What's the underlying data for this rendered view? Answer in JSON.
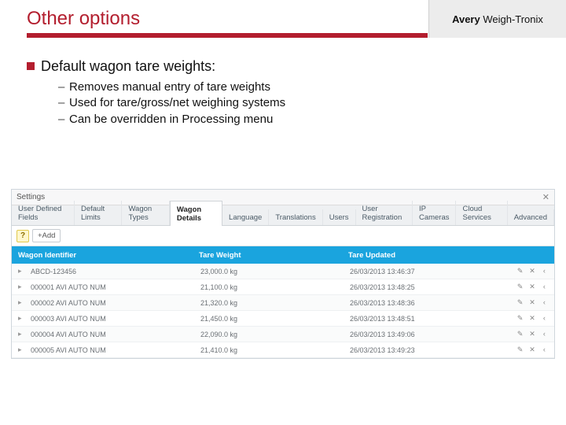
{
  "slide": {
    "title": "Other options",
    "brand": {
      "bold": "Avery",
      "rest": " Weigh-Tronix"
    },
    "heading": "Default wagon tare weights:",
    "subs": [
      "Removes manual entry of tare weights",
      "Used for tare/gross/net weighing systems",
      "Can be overridden in Processing menu"
    ]
  },
  "app": {
    "window_title": "Settings",
    "tabs": [
      "User Defined Fields",
      "Default Limits",
      "Wagon Types",
      "Wagon Details",
      "Language",
      "Translations",
      "Users",
      "User Registration",
      "IP Cameras",
      "Cloud Services",
      "Advanced"
    ],
    "active_tab_index": 3,
    "toolbar": {
      "help": "?",
      "add": "+Add"
    },
    "columns": {
      "id": "Wagon Identifier",
      "wt": "Tare Weight",
      "upd": "Tare Updated"
    },
    "rows": [
      {
        "id": "ABCD-123456",
        "wt": "23,000.0 kg",
        "upd": "26/03/2013 13:46:37"
      },
      {
        "id": "000001 AVI AUTO NUM",
        "wt": "21,100.0 kg",
        "upd": "26/03/2013 13:48:25"
      },
      {
        "id": "000002 AVI AUTO NUM",
        "wt": "21,320.0 kg",
        "upd": "26/03/2013 13:48:36"
      },
      {
        "id": "000003 AVI AUTO NUM",
        "wt": "21,450.0 kg",
        "upd": "26/03/2013 13:48:51"
      },
      {
        "id": "000004 AVI AUTO NUM",
        "wt": "22,090.0 kg",
        "upd": "26/03/2013 13:49:06"
      },
      {
        "id": "000005 AVI AUTO NUM",
        "wt": "21,410.0 kg",
        "upd": "26/03/2013 13:49:23"
      }
    ],
    "icons": {
      "expand": "▸",
      "edit": "✎",
      "delete": "✕",
      "more": "‹"
    }
  }
}
